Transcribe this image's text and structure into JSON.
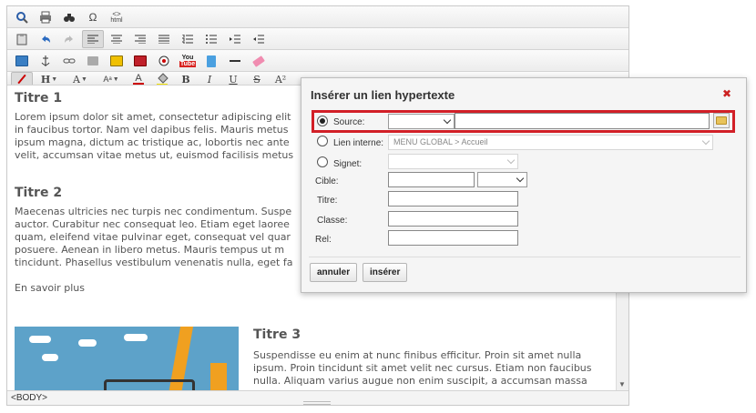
{
  "toolbar": {
    "html_label": "html",
    "omega": "Ω",
    "bold": "B",
    "italic": "I",
    "underline": "U",
    "strike": "S",
    "superscript": "A²",
    "fontcolor": "A",
    "heading": "H",
    "fontfamily": "A",
    "fontsize": "Aᵃ",
    "youtube_top": "You",
    "youtube_bottom": "Tube"
  },
  "content": {
    "titre1": "Titre 1",
    "para1": "Lorem ipsum dolor sit amet, consectetur adipiscing elit\nin faucibus tortor. Nam vel dapibus felis. Mauris metus\nipsum magna, dictum ac tristique ac, lobortis nec ante\nvelit, accumsan vitae metus ut, euismod facilisis metus",
    "titre2": "Titre 2",
    "para2": "Maecenas ultricies nec turpis nec condimentum. Suspe\nauctor. Curabitur nec consequat leo. Etiam eget laoree\nquam, eleifend vitae pulvinar eget, consequat vel quar\nposuere. Aenean in libero metus. Mauris tempus ut m\ntincidunt. Phasellus vestibulum venenatis nulla, eget fa",
    "link": "En savoir plus",
    "titre3": "Titre 3",
    "para3": "Suspendisse eu enim at nunc finibus efficitur. Proin sit amet nulla\nipsum. Proin tincidunt sit amet velit nec cursus. Etiam non faucibus\nnulla. Aliquam varius augue non enim suscipit, a accumsan massa"
  },
  "status": {
    "path": "<BODY>"
  },
  "dialog": {
    "title": "Insérer un lien hypertexte",
    "close": "✖",
    "source_label": "Source:",
    "internal_label": "Lien interne:",
    "internal_value": "MENU GLOBAL > Accueil",
    "signet_label": "Signet:",
    "cible_label": "Cible:",
    "titre_label": "Titre:",
    "classe_label": "Classe:",
    "rel_label": "Rel:",
    "cancel": "annuler",
    "insert": "insérer"
  },
  "colors": {
    "highlight": "#d21f27",
    "illustration_bg": "#5da2c9",
    "crane": "#f0a020"
  }
}
